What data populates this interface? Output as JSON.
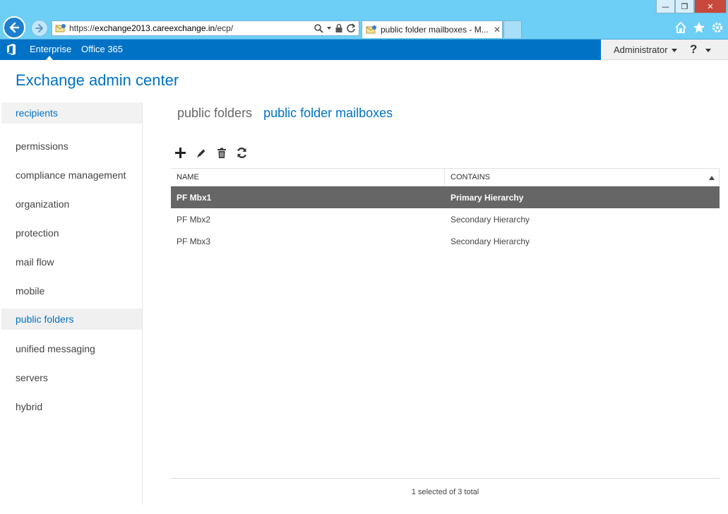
{
  "browser": {
    "url_prefix": "https://",
    "url_host": "exchange2013.careexchange.in",
    "url_path": "/ecp/",
    "tab_title": "public folder mailboxes - M...",
    "tab_close": "✕",
    "win_minimize": "—",
    "win_restore": "❐",
    "win_close": "✕"
  },
  "suite": {
    "enterprise": "Enterprise",
    "office365": "Office 365",
    "user": "Administrator",
    "help": "?"
  },
  "app": {
    "title": "Exchange admin center"
  },
  "nav": {
    "items": [
      {
        "label": "recipients"
      },
      {
        "label": "permissions"
      },
      {
        "label": "compliance management"
      },
      {
        "label": "organization"
      },
      {
        "label": "protection"
      },
      {
        "label": "mail flow"
      },
      {
        "label": "mobile"
      },
      {
        "label": "public folders"
      },
      {
        "label": "unified messaging"
      },
      {
        "label": "servers"
      },
      {
        "label": "hybrid"
      }
    ]
  },
  "subtabs": {
    "public_folders": "public folders",
    "public_folder_mailboxes": "public folder mailboxes"
  },
  "grid": {
    "col_name": "NAME",
    "col_contains": "CONTAINS",
    "rows": [
      {
        "name": "PF Mbx1",
        "contains": "Primary Hierarchy"
      },
      {
        "name": "PF Mbx2",
        "contains": "Secondary Hierarchy"
      },
      {
        "name": "PF Mbx3",
        "contains": "Secondary Hierarchy"
      }
    ]
  },
  "status": {
    "text": "1 selected of 3 total"
  },
  "colors": {
    "accent": "#0072c6",
    "selected_row": "#666666",
    "chrome": "#6dcff6"
  }
}
